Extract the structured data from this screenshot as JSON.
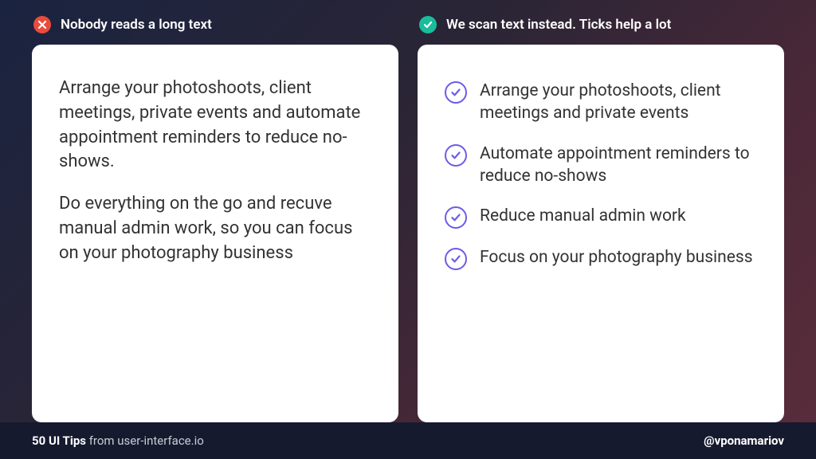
{
  "left": {
    "title": "Nobody reads a long text",
    "paragraphs": [
      "Arrange your photoshoots, client meetings, private events and automate appointment reminders to reduce no-shows.",
      "Do everything on the go and recuve manual admin work, so you can focus on your photography business"
    ]
  },
  "right": {
    "title": "We scan text instead. Ticks help a lot",
    "bullets": [
      "Arrange your photoshoots, client meetings and private events",
      "Automate appointment reminders to reduce no-shows",
      "Reduce manual admin work",
      "Focus on your photography business"
    ]
  },
  "footer": {
    "bold": "50 UI Tips",
    "light": " from user-interface.io",
    "handle": "@vponamariov"
  },
  "colors": {
    "bad": "#e74c3c",
    "good": "#1abc9c",
    "accent": "#6c5ce7"
  }
}
